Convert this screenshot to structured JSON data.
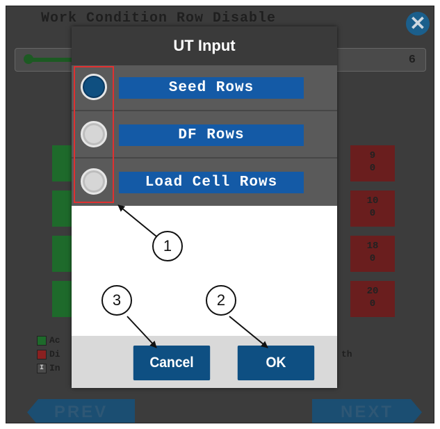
{
  "background": {
    "screen_title": "Work Condition Row Disable",
    "close_icon": "close-icon",
    "slider_value": "6",
    "green_tiles": [
      "",
      "",
      "",
      ""
    ],
    "red_tiles": [
      "9\n0",
      "10\n0",
      "18\n0",
      "20\n0"
    ],
    "legend": [
      "Ac",
      "Di",
      "In"
    ],
    "legend_badge": "I",
    "legend_right": "th",
    "prev_label": "PREV",
    "next_label": "NEXT"
  },
  "dialog": {
    "title": "UT Input",
    "options": [
      {
        "label": "Seed Rows",
        "selected": true
      },
      {
        "label": "DF Rows",
        "selected": false
      },
      {
        "label": "Load Cell Rows",
        "selected": false
      }
    ],
    "cancel_label": "Cancel",
    "ok_label": "OK"
  },
  "callouts": [
    "1",
    "2",
    "3"
  ],
  "colors": {
    "accent": "#0e4f82",
    "option_label_bg": "#145aa6",
    "highlight": "#e03030",
    "dialog_header": "#3a3a3a"
  }
}
